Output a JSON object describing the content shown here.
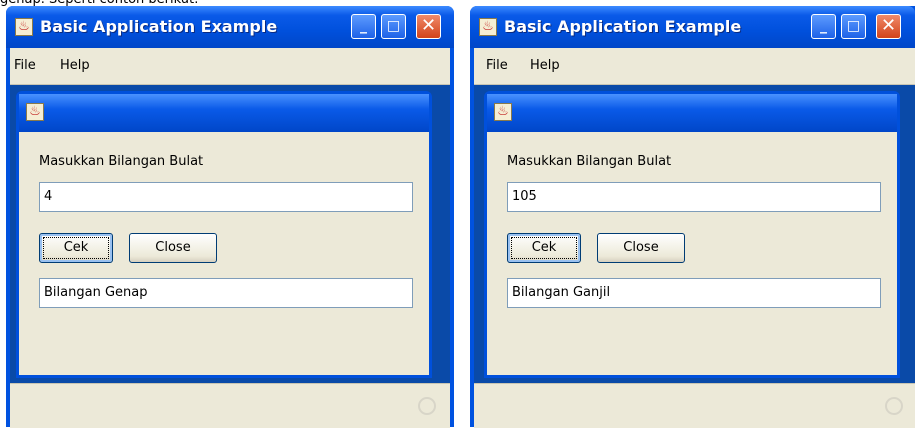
{
  "caption": "genap. Seperti contoh berikut:",
  "windows": [
    {
      "title": "Basic Application Example",
      "menu": [
        "File",
        "Help"
      ],
      "label": "Masukkan Bilangan Bulat",
      "input_value": "4",
      "cek_label": "Cek",
      "close_label": "Close",
      "output_value": "Bilangan Genap",
      "minimize": "_",
      "maximize": "□",
      "close": "✕",
      "app_icon": "java-cup-icon"
    },
    {
      "title": "Basic Application Example",
      "menu": [
        "File",
        "Help"
      ],
      "label": "Masukkan Bilangan Bulat",
      "input_value": "105",
      "cek_label": "Cek",
      "close_label": "Close",
      "output_value": "Bilangan Ganjil",
      "minimize": "_",
      "maximize": "□",
      "close": "✕",
      "app_icon": "java-cup-icon"
    }
  ],
  "colors": {
    "titlebar": "#0a5ae8",
    "desktop": "#0a4aa8",
    "panel": "#ece9d8",
    "close_button": "#d2431a"
  }
}
